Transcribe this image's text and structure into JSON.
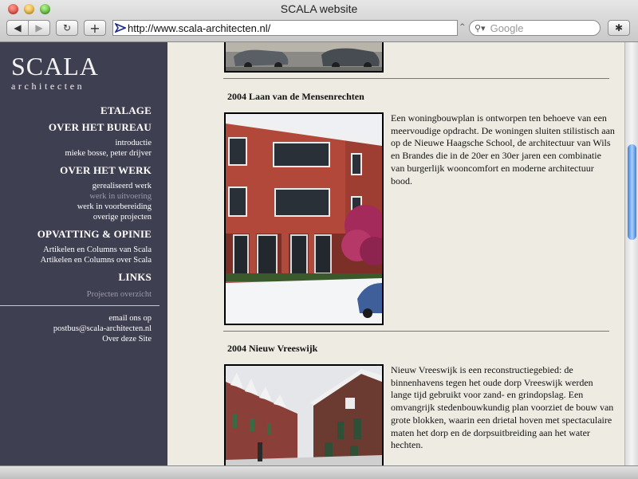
{
  "window": {
    "title": "SCALA website"
  },
  "toolbar": {
    "back_glyph": "◀",
    "forward_glyph": "▶",
    "reload_glyph": "↻",
    "add_glyph": "+",
    "url": "http://www.scala-architecten.nl/",
    "search_placeholder": "Google",
    "bug_glyph": "✱"
  },
  "sidebar": {
    "logo_main": "SCALA",
    "logo_sub": "architecten",
    "sections": [
      {
        "heading": "ETALAGE",
        "items": []
      },
      {
        "heading": "OVER HET BUREAU",
        "items": [
          {
            "label": "introductie",
            "dim": false
          },
          {
            "label": "mieke bosse, peter drijver",
            "dim": false
          }
        ]
      },
      {
        "heading": "OVER HET WERK",
        "items": [
          {
            "label": "gerealiseerd werk",
            "dim": false
          },
          {
            "label": "werk in uitvoering",
            "dim": true
          },
          {
            "label": "werk in voorbereiding",
            "dim": false
          },
          {
            "label": "overige projecten",
            "dim": false
          }
        ]
      },
      {
        "heading": "OPVATTING & OPINIE",
        "items": [
          {
            "label": "Artikelen en Columns van Scala",
            "dim": false
          },
          {
            "label": "Artikelen en Columns over Scala",
            "dim": false
          }
        ]
      },
      {
        "heading": "LINKS",
        "items": [
          {
            "label": "Projecten overzicht",
            "dim": true
          }
        ]
      }
    ],
    "footer": [
      "email ons op",
      "postbus@scala-architecten.nl",
      "Over deze Site"
    ]
  },
  "projects": [
    {
      "title": "2004 Laan van de Mensenrechten",
      "description": "Een woningbouwplan is ontworpen ten behoeve van een meervoudige opdracht. De woningen sluiten stilistisch aan op de Nieuwe Haagsche School, de architectuur van Wils en Brandes die in de 20er en 30er jaren een combinatie van burgerlijk wooncomfort en moderne architectuur bood."
    },
    {
      "title": "2004 Nieuw Vreeswijk",
      "description": "Nieuw Vreeswijk is een reconstructiegebied: de binnenhavens tegen het oude dorp Vreeswijk werden lange tijd gebruikt voor zand- en grindopslag. Een omvangrijk stedenbouwkundig plan voorziet de bouw van grote blokken, waarin een drietal hoven met spectaculaire maten het dorp en de dorpsuitbreiding aan het water hechten."
    }
  ]
}
